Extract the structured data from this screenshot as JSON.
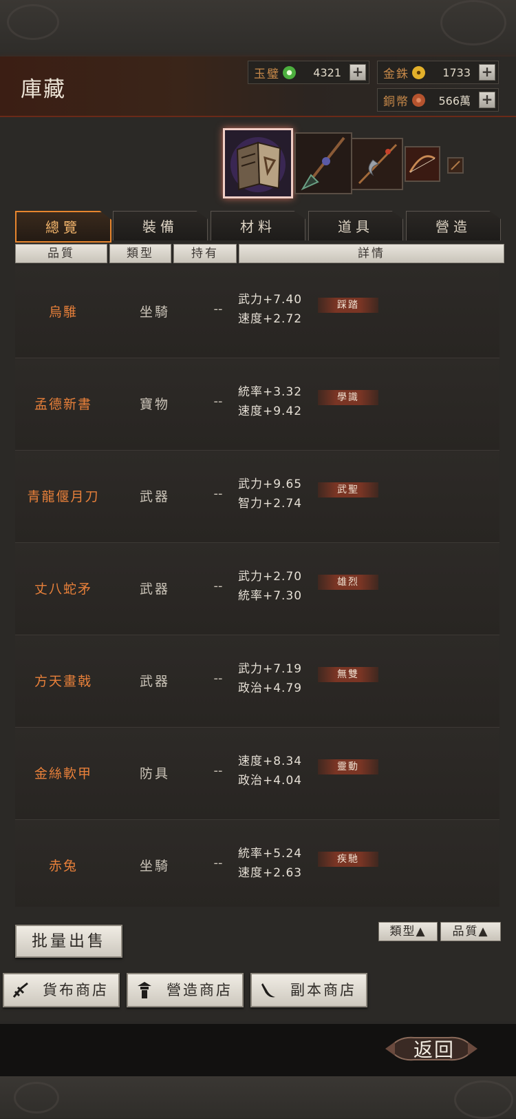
{
  "header": {
    "title": "庫藏"
  },
  "currencies": [
    {
      "label": "玉璧",
      "value": "4321",
      "coin": "jade-coin-icon",
      "color": "#4caf3e"
    },
    {
      "label": "金銖",
      "value": "1733",
      "coin": "gold-coin-icon",
      "color": "#d7a21c"
    },
    {
      "label": "銅幣",
      "value": "566萬",
      "coin": "copper-coin-icon",
      "color": "#b5532e"
    }
  ],
  "tabs": [
    "總覽",
    "裝備",
    "材料",
    "道具",
    "營造"
  ],
  "columns": [
    "品質",
    "類型",
    "持有",
    "詳情"
  ],
  "items": [
    {
      "name": "烏騅",
      "type": "坐騎",
      "owned": "--",
      "stat1": "武力",
      "val1": "+7.40",
      "stat2": "速度",
      "val2": "+2.72",
      "skill": "踩踏"
    },
    {
      "name": "孟德新書",
      "type": "寶物",
      "owned": "--",
      "stat1": "統率",
      "val1": "+3.32",
      "stat2": "速度",
      "val2": "+9.42",
      "skill": "學識"
    },
    {
      "name": "青龍偃月刀",
      "type": "武器",
      "owned": "--",
      "stat1": "武力",
      "val1": "+9.65",
      "stat2": "智力",
      "val2": "+2.74",
      "skill": "武聖"
    },
    {
      "name": "丈八蛇矛",
      "type": "武器",
      "owned": "--",
      "stat1": "武力",
      "val1": "+2.70",
      "stat2": "統率",
      "val2": "+7.30",
      "skill": "雄烈"
    },
    {
      "name": "方天畫戟",
      "type": "武器",
      "owned": "--",
      "stat1": "武力",
      "val1": "+7.19",
      "stat2": "政治",
      "val2": "+4.79",
      "skill": "無雙"
    },
    {
      "name": "金絲軟甲",
      "type": "防具",
      "owned": "--",
      "stat1": "速度",
      "val1": "+8.34",
      "stat2": "政治",
      "val2": "+4.04",
      "skill": "靈動"
    },
    {
      "name": "赤兔",
      "type": "坐騎",
      "owned": "--",
      "stat1": "統率",
      "val1": "+5.24",
      "stat2": "速度",
      "val2": "+2.63",
      "skill": "疾馳"
    }
  ],
  "actions": {
    "bulk_sell": "批量出售",
    "sort_type": "類型▲",
    "sort_quality": "品質▲"
  },
  "shops": [
    {
      "label": "貨布商店",
      "icon": "coin-shop-icon"
    },
    {
      "label": "營造商店",
      "icon": "tower-shop-icon"
    },
    {
      "label": "副本商店",
      "icon": "dungeon-shop-icon"
    }
  ],
  "footer": {
    "back_label": "返回"
  }
}
